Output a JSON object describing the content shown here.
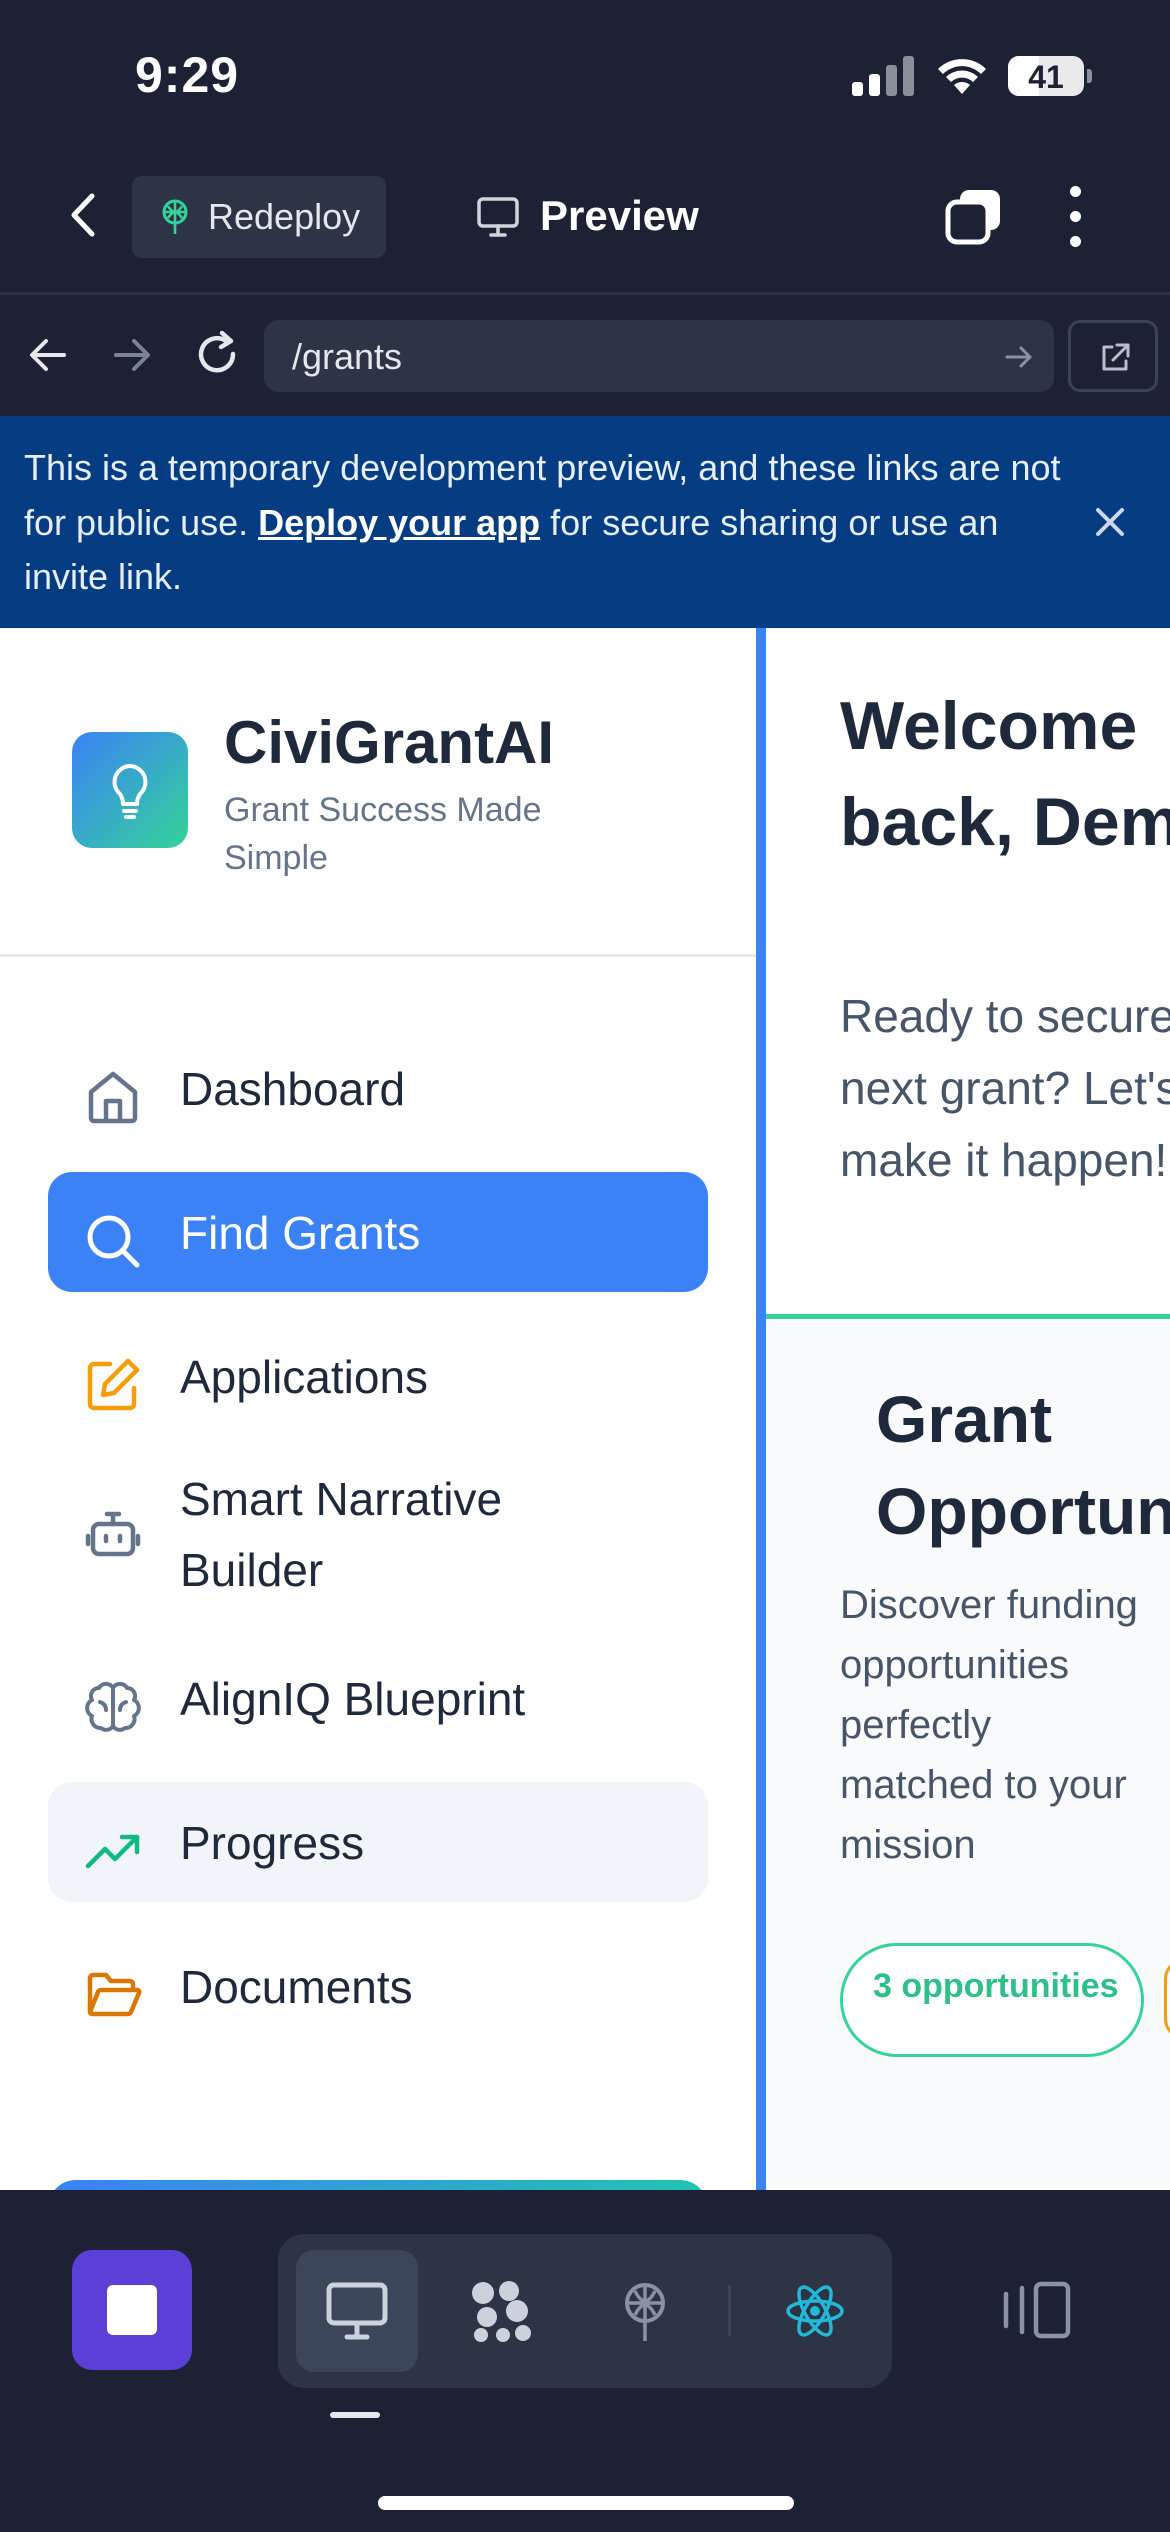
{
  "status_bar": {
    "time": "9:29",
    "battery": "41"
  },
  "toolbar": {
    "redeploy_label": "Redeploy",
    "preview_label": "Preview"
  },
  "url_bar": {
    "path": "/grants"
  },
  "banner": {
    "text_before": "This is a temporary development preview, and these links are not for public use. ",
    "link_text": "Deploy your app",
    "text_after": " for secure sharing or use an invite link."
  },
  "sidebar": {
    "brand_name": "CiviGrantAI",
    "brand_tagline": "Grant Success Made Simple",
    "items": [
      {
        "label": "Dashboard",
        "icon": "home-icon",
        "state": "default"
      },
      {
        "label": "Find Grants",
        "icon": "search-icon",
        "state": "active"
      },
      {
        "label": "Applications",
        "icon": "edit-icon",
        "state": "default"
      },
      {
        "label": "Smart Narrative Builder",
        "icon": "bot-icon",
        "state": "default"
      },
      {
        "label": "AlignIQ Blueprint",
        "icon": "brain-icon",
        "state": "default"
      },
      {
        "label": "Progress",
        "icon": "trending-up-icon",
        "state": "hover"
      },
      {
        "label": "Documents",
        "icon": "folder-open-icon",
        "state": "default"
      }
    ]
  },
  "main": {
    "welcome_title": "Welcome back, Demo!",
    "welcome_sub": "Ready to secure your next grant? Let's make it happen!",
    "card_title": "Grant Opportunities",
    "card_sub": "Discover funding opportunities perfectly matched to your mission",
    "pill": "3 opportunities"
  },
  "colors": {
    "chrome_bg": "#1c2233",
    "banner_bg": "#063c82",
    "accent_blue": "#3b82f6",
    "accent_green": "#34d399",
    "stop_button": "#5b3fd6"
  }
}
